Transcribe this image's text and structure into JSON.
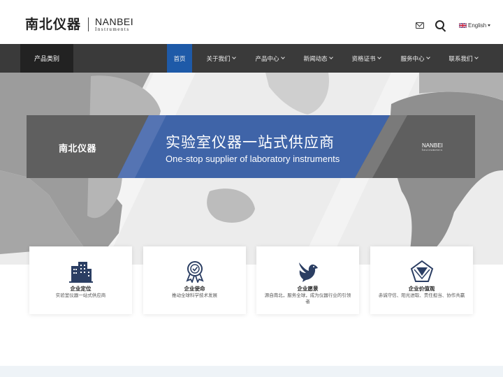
{
  "header": {
    "logo_cn": "南北仪器",
    "logo_en": "NANBEI",
    "logo_en_sub": "Instruments",
    "language": "English"
  },
  "nav": {
    "category": "产品类别",
    "items": [
      {
        "label": "首页",
        "active": true,
        "has_dropdown": false
      },
      {
        "label": "关于我们",
        "active": false,
        "has_dropdown": true
      },
      {
        "label": "产品中心",
        "active": false,
        "has_dropdown": true
      },
      {
        "label": "新闻动态",
        "active": false,
        "has_dropdown": true
      },
      {
        "label": "资格证书",
        "active": false,
        "has_dropdown": true
      },
      {
        "label": "服务中心",
        "active": false,
        "has_dropdown": true
      },
      {
        "label": "联系我们",
        "active": false,
        "has_dropdown": true
      }
    ]
  },
  "banner": {
    "title": "实验室仪器一站式供应商",
    "subtitle": "One-stop supplier of laboratory instruments",
    "logo_cn": "南北仪器",
    "logo_en": "NANBEI",
    "logo_en_sub": "Instruments"
  },
  "cards": [
    {
      "icon": "building-icon",
      "title": "企业定位",
      "desc": "实验室仪器一站式供应商"
    },
    {
      "icon": "award-ribbon-icon",
      "title": "企业使命",
      "desc": "推动全球科学技术发展"
    },
    {
      "icon": "dove-icon",
      "title": "企业愿景",
      "desc": "源自南北，服务全球，成为仪器行业的引领者"
    },
    {
      "icon": "diamond-icon",
      "title": "企业价值观",
      "desc": "赤诚守信、阳光进取、责任担当、协作共赢"
    }
  ],
  "colors": {
    "nav_bg": "#3a3a3a",
    "category_bg": "#222222",
    "active_blue": "#1e5aa8",
    "icon_blue": "#2b3e63"
  }
}
